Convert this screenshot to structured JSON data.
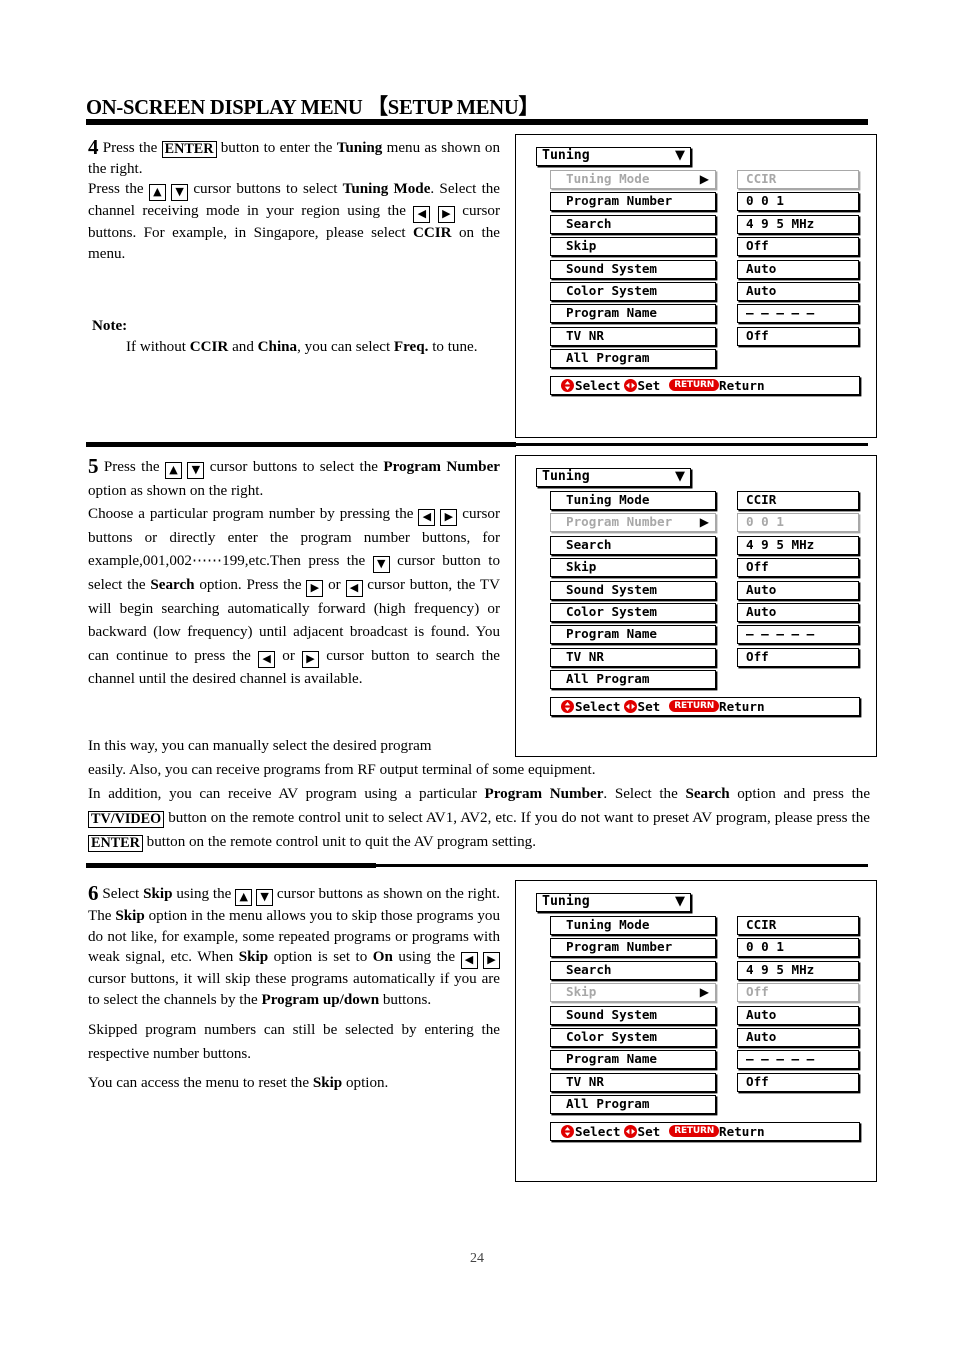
{
  "document": {
    "title": "ON-SCREEN DISPLAY MENU 【SETUP MENU】",
    "page_number": "24"
  },
  "colors": {
    "accent_red": "#e10000",
    "dim_gray": "#a8a8a8",
    "ink": "#000000"
  },
  "sections": [
    {
      "step": "4",
      "paragraphs": {
        "p1_a": "Press the ",
        "p1_key": "ENTER",
        "p1_b": " button to enter the ",
        "p1_bold1": "Tuning",
        "p1_c": " menu as shown on the right.",
        "p2_a": "Press the ",
        "p2_b": " cursor buttons to select ",
        "p2_bold1": "Tuning Mode",
        "p2_c": ". Select the channel receiving mode in your region using the ",
        "p2_d": " cursor buttons. For example, in Singapore, please select ",
        "p2_bold2": "CCIR",
        "p2_e": " on the menu.",
        "note_heading": "Note:",
        "note_a": "If without ",
        "note_bold1": "CCIR",
        "note_b": " and ",
        "note_bold2": "China",
        "note_c": ", you can select ",
        "note_bold3": "Freq.",
        "note_d": " to tune."
      }
    },
    {
      "step": "5",
      "paragraphs": {
        "p1_a": "Press the ",
        "p1_b": " cursor buttons to select the ",
        "p1_bold1": "Program Number",
        "p1_c": " option as shown on the right.",
        "p2_a": "Choose a particular program number by pressing the ",
        "p2_b": " cursor buttons or directly enter the program number buttons, for example,001,002⋯⋯199,etc.Then press the ",
        "p2_c": " cursor button to select the ",
        "p2_bold1": "Search",
        "p2_d": " option. Press the ",
        "p2_e": " or ",
        "p2_f": " cursor button, the TV will begin searching automatically forward (high frequency) or backward (low frequency) until adjacent broadcast is found. You can continue to press the ",
        "p2_g": " or ",
        "p2_h": " cursor button to search the channel until the desired channel is available.",
        "wide1": "In this way, you can manually select the desired program",
        "wide2": "easily. Also, you can receive programs from RF output terminal of some equipment.",
        "wide3_a": "In addition, you can receive AV program using a particular ",
        "wide3_bold1": "Program Number",
        "wide3_b": ". Select the ",
        "wide3_bold2": "Search",
        "wide3_c": " option and press the ",
        "wide3_key1": "TV/VIDEO",
        "wide3_d": " button on the remote control unit to select AV1, AV2, etc. If you do not want to preset AV program, please press the ",
        "wide3_key2": "ENTER",
        "wide3_e": " button on the remote control unit to quit the AV program setting."
      }
    },
    {
      "step": "6",
      "paragraphs": {
        "p1_a": "Select ",
        "p1_bold1": "Skip",
        "p1_b": " using the ",
        "p1_c": " cursor buttons as shown on the right. The ",
        "p1_bold2": "Skip",
        "p1_d": " option in the menu allows you to skip those programs you do not like, for example, some repeated programs or programs with weak signal, etc. When ",
        "p1_bold3": "Skip",
        "p1_e": " option is set to ",
        "p1_bold4": "On",
        "p1_f": " using the ",
        "p1_g": " cursor buttons, it will skip these programs automatically if you are to select the channels by the ",
        "p1_bold5": "Program up/down",
        "p1_h": " buttons.",
        "p2": "Skipped program numbers can still be selected by entering the respective number buttons.",
        "p3_a": "You can access the menu to reset the ",
        "p3_bold1": "Skip",
        "p3_b": " option."
      }
    }
  ],
  "osd_menus": [
    {
      "id": "menu-step-4",
      "title": "Tuning",
      "caret": "▼",
      "active_row": 0,
      "rows": [
        {
          "label": "Tuning Mode",
          "value": "CCIR",
          "dim": true,
          "arrow": "▶"
        },
        {
          "label": "Program Number",
          "value": "0 0 1",
          "dim": false,
          "arrow": ""
        },
        {
          "label": "Search",
          "value": "4 9 5 MHz",
          "dim": false,
          "arrow": ""
        },
        {
          "label": "Skip",
          "value": "Off",
          "dim": false,
          "arrow": ""
        },
        {
          "label": "Sound System",
          "value": "Auto",
          "dim": false,
          "arrow": ""
        },
        {
          "label": "Color System",
          "value": "Auto",
          "dim": false,
          "arrow": ""
        },
        {
          "label": "Program Name",
          "value": "– – – – –",
          "dim": false,
          "arrow": ""
        },
        {
          "label": "TV NR",
          "value": "Off",
          "dim": false,
          "arrow": ""
        },
        {
          "label": "All Program",
          "value": "",
          "dim": false,
          "arrow": ""
        }
      ],
      "footer": {
        "select_label": "Select",
        "set_label": "Set",
        "return_badge": "RETURN",
        "return_label": "Return"
      }
    },
    {
      "id": "menu-step-5",
      "title": "Tuning",
      "caret": "▼",
      "active_row": 1,
      "rows": [
        {
          "label": "Tuning Mode",
          "value": "CCIR",
          "dim": false,
          "arrow": ""
        },
        {
          "label": "Program Number",
          "value": "0 0 1",
          "dim": true,
          "arrow": "▶"
        },
        {
          "label": "Search",
          "value": "4 9 5 MHz",
          "dim": false,
          "arrow": ""
        },
        {
          "label": "Skip",
          "value": "Off",
          "dim": false,
          "arrow": ""
        },
        {
          "label": "Sound System",
          "value": "Auto",
          "dim": false,
          "arrow": ""
        },
        {
          "label": "Color System",
          "value": "Auto",
          "dim": false,
          "arrow": ""
        },
        {
          "label": "Program Name",
          "value": "– – – – –",
          "dim": false,
          "arrow": ""
        },
        {
          "label": "TV NR",
          "value": "Off",
          "dim": false,
          "arrow": ""
        },
        {
          "label": "All Program",
          "value": "",
          "dim": false,
          "arrow": ""
        }
      ],
      "footer": {
        "select_label": "Select",
        "set_label": "Set",
        "return_badge": "RETURN",
        "return_label": "Return"
      }
    },
    {
      "id": "menu-step-6",
      "title": "Tuning",
      "caret": "▼",
      "active_row": 3,
      "rows": [
        {
          "label": "Tuning Mode",
          "value": "CCIR",
          "dim": false,
          "arrow": ""
        },
        {
          "label": "Program Number",
          "value": "0 0 1",
          "dim": false,
          "arrow": ""
        },
        {
          "label": "Search",
          "value": "4 9 5 MHz",
          "dim": false,
          "arrow": ""
        },
        {
          "label": "Skip",
          "value": "Off",
          "dim": true,
          "arrow": "▶"
        },
        {
          "label": "Sound System",
          "value": "Auto",
          "dim": false,
          "arrow": ""
        },
        {
          "label": "Color System",
          "value": "Auto",
          "dim": false,
          "arrow": ""
        },
        {
          "label": "Program Name",
          "value": "– – – – –",
          "dim": false,
          "arrow": ""
        },
        {
          "label": "TV NR",
          "value": "Off",
          "dim": false,
          "arrow": ""
        },
        {
          "label": "All Program",
          "value": "",
          "dim": false,
          "arrow": ""
        }
      ],
      "footer": {
        "select_label": "Select",
        "set_label": "Set",
        "return_badge": "RETURN",
        "return_label": "Return"
      }
    }
  ],
  "glyphs": {
    "up": "▲",
    "down": "▼",
    "left": "◀",
    "right": "▶"
  }
}
